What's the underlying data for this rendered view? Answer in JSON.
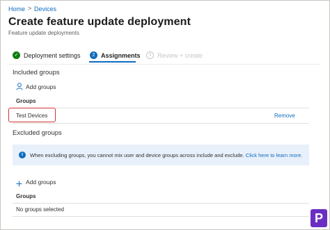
{
  "breadcrumb": {
    "items": [
      "Home",
      "Devices"
    ],
    "separator": ">"
  },
  "header": {
    "title": "Create feature update deployment",
    "more": "...",
    "subtitle": "Feature update deployments"
  },
  "steps": [
    {
      "label": "Deployment settings",
      "marker": "✓",
      "state": "completed"
    },
    {
      "label": "Assignments",
      "marker": "2",
      "state": "active"
    },
    {
      "label": "Review + create",
      "marker": "3",
      "state": "inactive"
    }
  ],
  "included": {
    "heading": "Included groups",
    "add_label": "Add groups",
    "column": "Groups",
    "rows": [
      {
        "name": "Test Devices",
        "action": "Remove"
      }
    ]
  },
  "excluded": {
    "heading": "Excluded groups",
    "info_text": "When excluding groups, you cannot mix user and device groups across include and exclude.",
    "info_link": "Click here to learn more.",
    "info_icon": "i",
    "add_label": "Add groups",
    "column": "Groups",
    "empty_text": "No groups selected"
  },
  "colors": {
    "accent": "#0f6cbd",
    "success": "#107c10",
    "highlight": "#d13438",
    "info_bg": "#e8f0fb",
    "logo": "#6a2fc2"
  },
  "logo": {
    "letter": "P"
  }
}
